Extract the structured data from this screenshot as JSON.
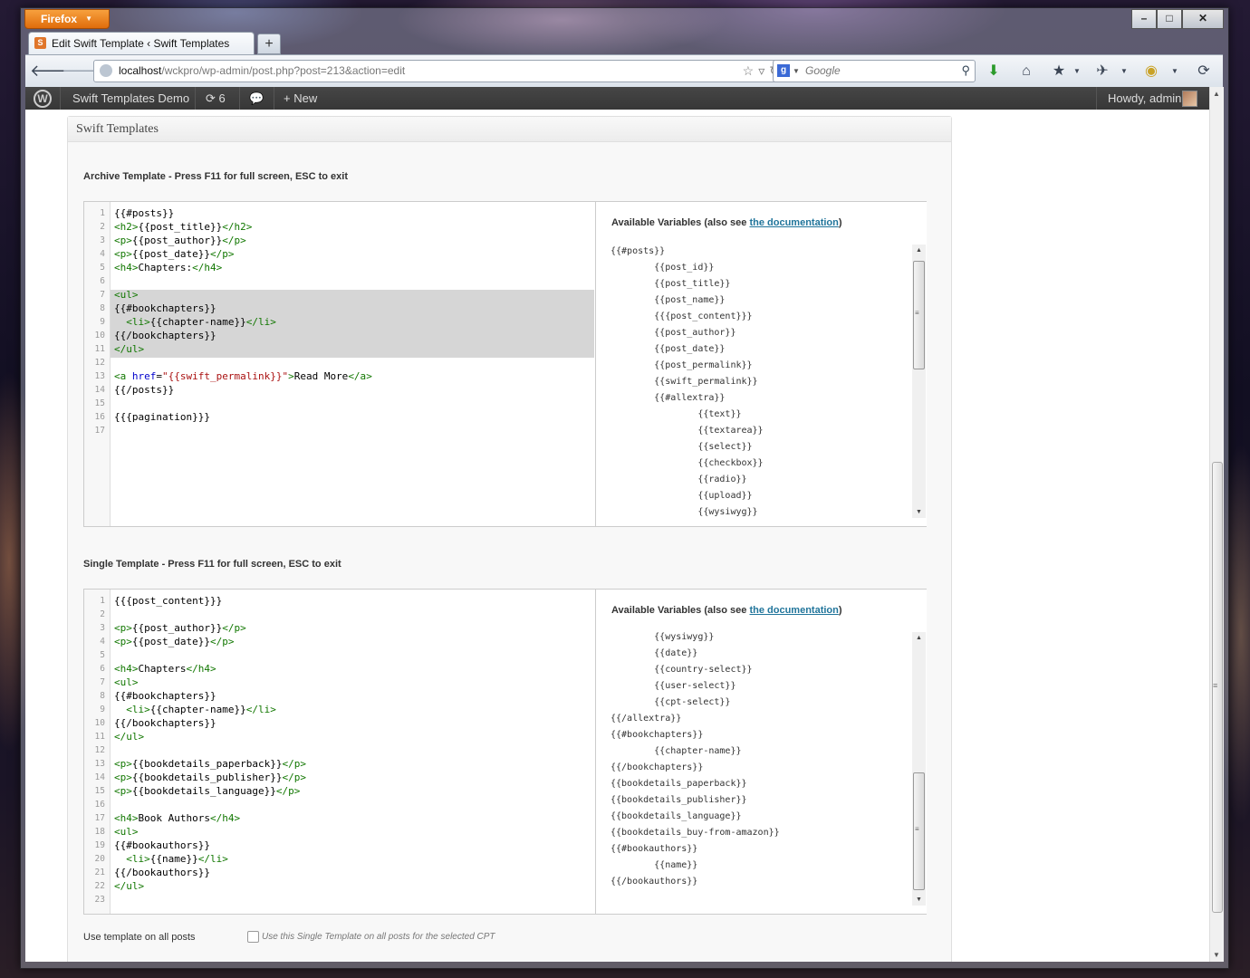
{
  "browser": {
    "menu_button": "Firefox",
    "tab_title": "Edit Swift Template ‹ Swift Templates De...",
    "url_host": "localhost",
    "url_path": "/wckpro/wp-admin/post.php?post=213&action=edit",
    "search_placeholder": "Google"
  },
  "adminbar": {
    "site_name": "Swift Templates Demo",
    "updates_count": "6",
    "new_label": "New",
    "howdy": "Howdy, admin"
  },
  "metabox": {
    "title": "Swift Templates",
    "archive_label": "Archive Template - Press F11 for full screen, ESC to exit",
    "single_label": "Single Template - Press F11 for full screen, ESC to exit",
    "variables_title": "Available Variables (also see ",
    "variables_link": "the documentation",
    "variables_close": ")",
    "use_on_all_label": "Use template on all posts",
    "use_on_all_desc": "Use this Single Template on all posts for the selected CPT"
  },
  "archive_editor": {
    "line_numbers": [
      "1",
      "2",
      "3",
      "4",
      "5",
      "6",
      "7",
      "8",
      "9",
      "10",
      "11",
      "12",
      "13",
      "14",
      "15",
      "16",
      "17"
    ],
    "lines": [
      "{{#posts}}",
      "<h2>{{post_title}}</h2>",
      "<p>{{post_author}}</p>",
      "<p>{{post_date}}</p>",
      "<h4>Chapters:</h4>",
      "",
      "<ul>",
      "{{#bookchapters}}",
      "  <li>{{chapter-name}}</li>",
      "{{/bookchapters}}",
      "</ul>",
      "",
      "<a href=\"{{swift_permalink}}\">Read More</a>",
      "{{/posts}}",
      "",
      "{{{pagination}}}",
      ""
    ]
  },
  "archive_vars": [
    "{{#posts}}",
    "        {{post_id}}",
    "        {{post_title}}",
    "        {{post_name}}",
    "        {{{post_content}}}",
    "        {{post_author}}",
    "        {{post_date}}",
    "        {{post_permalink}}",
    "        {{swift_permalink}}",
    "        {{#allextra}}",
    "                {{text}}",
    "                {{textarea}}",
    "                {{select}}",
    "                {{checkbox}}",
    "                {{radio}}",
    "                {{upload}}",
    "                {{wysiwyg}}"
  ],
  "single_editor": {
    "line_numbers": [
      "1",
      "2",
      "3",
      "4",
      "5",
      "6",
      "7",
      "8",
      "9",
      "10",
      "11",
      "12",
      "13",
      "14",
      "15",
      "16",
      "17",
      "18",
      "19",
      "20",
      "21",
      "22",
      "23"
    ],
    "lines": [
      "{{{post_content}}}",
      "",
      "<p>{{post_author}}</p>",
      "<p>{{post_date}}</p>",
      "",
      "<h4>Chapters</h4>",
      "<ul>",
      "{{#bookchapters}}",
      "  <li>{{chapter-name}}</li>",
      "{{/bookchapters}}",
      "</ul>",
      "",
      "<p>{{bookdetails_paperback}}</p>",
      "<p>{{bookdetails_publisher}}</p>",
      "<p>{{bookdetails_language}}</p>",
      "",
      "<h4>Book Authors</h4>",
      "<ul>",
      "{{#bookauthors}}",
      "  <li>{{name}}</li>",
      "{{/bookauthors}}",
      "</ul>",
      ""
    ]
  },
  "single_vars": [
    "        {{wysiwyg}}",
    "        {{date}}",
    "        {{country-select}}",
    "        {{user-select}}",
    "        {{cpt-select}}",
    "{{/allextra}}",
    "{{#bookchapters}}",
    "        {{chapter-name}}",
    "{{/bookchapters}}",
    "{{bookdetails_paperback}}",
    "{{bookdetails_publisher}}",
    "{{bookdetails_language}}",
    "{{bookdetails_buy-from-amazon}}",
    "{{#bookauthors}}",
    "        {{name}}",
    "{{/bookauthors}}"
  ],
  "colors": {
    "wp_link": "#21759b",
    "code_tag": "#117700",
    "firefox_orange": "#e06c0b",
    "adminbar_bg": "#464646"
  }
}
